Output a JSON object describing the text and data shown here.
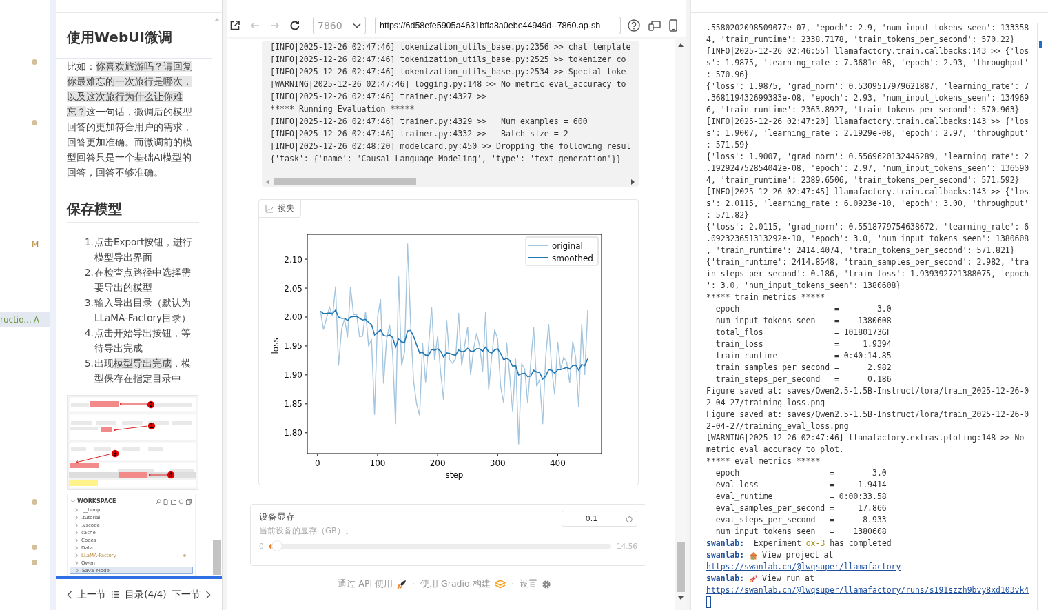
{
  "explorer_strip": {
    "rows": [
      {
        "kind": "dot",
        "color": "#d3bf9c"
      },
      {
        "kind": "blank"
      },
      {
        "kind": "blank"
      },
      {
        "kind": "blank"
      },
      {
        "kind": "dot",
        "color": "#d3bf9c"
      },
      {
        "kind": "blank"
      },
      {
        "kind": "blank"
      },
      {
        "kind": "blank"
      },
      {
        "kind": "blank"
      },
      {
        "kind": "blank"
      },
      {
        "kind": "blank"
      },
      {
        "kind": "blank"
      },
      {
        "kind": "status",
        "status": "M",
        "color": "#b5893f"
      },
      {
        "kind": "blank"
      },
      {
        "kind": "blank"
      },
      {
        "kind": "blank"
      },
      {
        "kind": "blank"
      },
      {
        "kind": "file",
        "name": "ructio...",
        "status": "A",
        "color": "#6b9a3e",
        "selected": true
      },
      {
        "kind": "blank"
      },
      {
        "kind": "blank"
      },
      {
        "kind": "blank"
      },
      {
        "kind": "blank"
      },
      {
        "kind": "blank"
      },
      {
        "kind": "blank"
      },
      {
        "kind": "blank"
      },
      {
        "kind": "blank"
      },
      {
        "kind": "blank"
      },
      {
        "kind": "blank"
      },
      {
        "kind": "blank"
      },
      {
        "kind": "dot",
        "color": "#d3bf9c"
      },
      {
        "kind": "blank"
      },
      {
        "kind": "blank"
      },
      {
        "kind": "dot",
        "color": "#d3bf9c"
      },
      {
        "kind": "dot",
        "color": "#d3bf9c"
      }
    ]
  },
  "tutorial": {
    "title": "使用WebUI微调",
    "paragraph": [
      {
        "kind": "text",
        "text": "比如："
      },
      {
        "kind": "code",
        "text": "你喜欢旅游吗？请回复你最难忘的一次旅行是哪次，以及这次旅行为什么让你难忘？"
      },
      {
        "kind": "text",
        "text": "这一句话，微调后的模型回答的更加符合用户的需求，回答更加准确。而微调前的模型回答只是一个基础AI模型的回答，回答不够准确。"
      }
    ],
    "heading": "保存模型",
    "steps": [
      {
        "number": "1.",
        "parts": [
          {
            "kind": "text",
            "text": "点击Export按钮，进行模型导出界面"
          }
        ]
      },
      {
        "number": "2.",
        "parts": [
          {
            "kind": "text",
            "text": "在检查点路径中选择需要导出的模型"
          }
        ]
      },
      {
        "number": "3.",
        "parts": [
          {
            "kind": "text",
            "text": "输入导出目录（默认为LLaMA-Factory目录）"
          }
        ]
      },
      {
        "number": "4.",
        "parts": [
          {
            "kind": "text",
            "text": "点击开始导出按钮，等待导出完成"
          }
        ]
      },
      {
        "number": "5.",
        "parts": [
          {
            "kind": "text",
            "text": "出现"
          },
          {
            "kind": "code",
            "text": "模型导出完成"
          },
          {
            "kind": "text",
            "text": "，模型保存在指定目录中"
          }
        ]
      }
    ],
    "figure_callouts": [
      "2",
      "1",
      "3",
      "4"
    ],
    "workspace": {
      "title": "WORKSPACE",
      "folders": [
        {
          "name": ".__temp",
          "modified": false,
          "selected": false
        },
        {
          "name": ".tutorial",
          "modified": false,
          "selected": false
        },
        {
          "name": ".vscode",
          "modified": false,
          "selected": false
        },
        {
          "name": "cache",
          "modified": false,
          "selected": false
        },
        {
          "name": "Codes",
          "modified": false,
          "selected": false
        },
        {
          "name": "Data",
          "modified": false,
          "selected": false
        },
        {
          "name": "LLaMA-Factory",
          "modified": true,
          "selected": false
        },
        {
          "name": "Qwen",
          "modified": false,
          "selected": false
        },
        {
          "name": "Sava_Model",
          "modified": false,
          "selected": true
        }
      ]
    },
    "nav": {
      "prev": "上一节",
      "toc": "目录(4/4)",
      "next": "下一节"
    }
  },
  "browser": {
    "nav_buttons": [
      {
        "kind": "external",
        "disabled": false
      },
      {
        "kind": "back",
        "disabled": true
      },
      {
        "kind": "forward",
        "disabled": true
      },
      {
        "kind": "reload",
        "disabled": false
      }
    ],
    "port": "7860",
    "url": "https://6d58efe5905a4631bffa8a0ebe44949d--7860.ap-sh",
    "tools": [
      {
        "kind": "help"
      },
      {
        "kind": "devices"
      },
      {
        "kind": "phone"
      }
    ]
  },
  "gradio": {
    "log_lines": [
      "[INFO|2025-12-26 02:47:46] tokenization_utils_base.py:2356 >> chat template",
      "[INFO|2025-12-26 02:47:46] tokenization_utils_base.py:2525 >> tokenizer co",
      "[INFO|2025-12-26 02:47:46] tokenization_utils_base.py:2534 >> Special toke",
      "[WARNING|2025-12-26 02:47:46] logging.py:148 >> No metric eval_accuracy to",
      "[INFO|2025-12-26 02:47:46] trainer.py:4327 >>",
      "***** Running Evaluation *****",
      "[INFO|2025-12-26 02:47:46] trainer.py:4329 >>   Num examples = 600",
      "[INFO|2025-12-26 02:47:46] trainer.py:4332 >>   Batch size = 2",
      "[INFO|2025-12-26 02:48:20] modelcard.py:450 >> Dropping the following resul",
      "{'task': {'name': 'Causal Language Modeling', 'type': 'text-generation'}}"
    ],
    "plot_tab": "损失",
    "chart_data": {
      "type": "line",
      "xlabel": "step",
      "ylabel": "loss",
      "x": [
        5,
        10,
        15,
        20,
        25,
        30,
        35,
        40,
        45,
        50,
        55,
        60,
        65,
        70,
        75,
        80,
        85,
        90,
        95,
        100,
        105,
        110,
        115,
        120,
        125,
        130,
        135,
        140,
        145,
        150,
        155,
        160,
        165,
        170,
        175,
        180,
        185,
        190,
        195,
        200,
        205,
        210,
        215,
        220,
        225,
        230,
        235,
        240,
        245,
        250,
        255,
        260,
        265,
        270,
        275,
        280,
        285,
        290,
        295,
        300,
        305,
        310,
        315,
        320,
        325,
        330,
        335,
        340,
        345,
        350,
        355,
        360,
        365,
        370,
        375,
        380,
        385,
        390,
        395,
        400,
        405,
        410,
        415,
        420,
        425,
        430,
        435,
        440,
        445,
        450
      ],
      "series": [
        {
          "name": "original",
          "color": "#a3c5de",
          "values": [
            2.01,
            1.978,
            1.998,
            2.017,
            2.001,
            2.053,
            1.916,
            1.978,
            1.997,
            1.965,
            2.052,
            2.004,
            2.005,
            1.966,
            1.967,
            2.009,
            1.951,
            1.96,
            1.831,
            2.0,
            2.031,
            1.885,
            1.96,
            1.987,
            1.94,
            1.815,
            2.07,
            1.916,
            1.94,
            2.127,
            1.99,
            1.89,
            1.85,
            1.83,
            1.955,
            1.887,
            1.95,
            2.017,
            1.926,
            1.967,
            1.905,
            1.856,
            1.995,
            1.926,
            1.92,
            1.928,
            2.007,
            1.916,
            1.95,
            1.982,
            1.9,
            1.945,
            1.972,
            1.95,
            1.906,
            2.009,
            1.874,
            1.93,
            1.978,
            1.962,
            1.88,
            1.851,
            1.956,
            1.9,
            1.836,
            1.928,
            1.78,
            1.919,
            1.91,
            1.852,
            1.92,
            1.982,
            1.88,
            1.892,
            1.815,
            1.932,
            1.988,
            1.91,
            1.866,
            1.957,
            1.91,
            1.93,
            1.922,
            1.886,
            1.958,
            1.93,
            1.844,
            1.988,
            1.9,
            2.012
          ]
        },
        {
          "name": "smoothed",
          "color": "#1f77b4",
          "values": [
            2.01,
            2.006,
            2.006,
            2.007,
            2.006,
            2.012,
            2.0,
            1.998,
            1.998,
            1.994,
            2.0,
            2.001,
            2.001,
            1.998,
            1.995,
            1.996,
            1.991,
            1.987,
            1.969,
            1.973,
            1.978,
            1.968,
            1.967,
            1.969,
            1.965,
            1.948,
            1.962,
            1.957,
            1.956,
            1.976,
            1.977,
            1.967,
            1.952,
            1.938,
            1.939,
            1.934,
            1.934,
            1.944,
            1.943,
            1.945,
            1.941,
            1.931,
            1.938,
            1.937,
            1.935,
            1.934,
            1.943,
            1.94,
            1.941,
            1.946,
            1.941,
            1.941,
            1.945,
            1.945,
            1.941,
            1.948,
            1.94,
            1.938,
            1.943,
            1.945,
            1.937,
            1.926,
            1.929,
            1.925,
            1.915,
            1.916,
            1.9,
            1.902,
            1.903,
            1.897,
            1.898,
            1.908,
            1.905,
            1.904,
            1.893,
            1.898,
            1.909,
            1.908,
            1.903,
            1.909,
            1.909,
            1.911,
            1.913,
            1.91,
            1.916,
            1.917,
            1.908,
            1.918,
            1.916,
            1.928
          ]
        }
      ],
      "legend": "upper right",
      "xlim": [
        -17,
        473
      ],
      "ylim": [
        1.764,
        2.143
      ],
      "xticks": [
        0,
        100,
        200,
        300,
        400
      ],
      "yticks": [
        {
          "value": 1.8,
          "label": "1.80"
        },
        {
          "value": 1.85,
          "label": "1.85"
        },
        {
          "value": 1.9,
          "label": "1.90"
        },
        {
          "value": 1.95,
          "label": "1.95"
        },
        {
          "value": 2.0,
          "label": "2.00"
        },
        {
          "value": 2.05,
          "label": "2.05"
        },
        {
          "value": 2.1,
          "label": "2.10"
        }
      ]
    },
    "slider": {
      "label": "设备显存",
      "info": "当前设备的显存（GB）。",
      "value": "0.1",
      "min": "0",
      "max": "14.56",
      "level": 0.007
    },
    "footer": [
      {
        "kind": "api",
        "text": "通过 API 使用"
      },
      {
        "kind": "separator",
        "text": "·"
      },
      {
        "kind": "gradio",
        "text": "使用 Gradio 构建"
      },
      {
        "kind": "separator",
        "text": "·"
      },
      {
        "kind": "settings",
        "text": "设置"
      }
    ]
  },
  "terminal": {
    "lines": [
      {
        "kind": "text",
        "text": ".5580202098509077e-07, 'epoch': 2.9, 'num_input_tokens_seen': 133358"
      },
      {
        "kind": "text",
        "text": "4, 'train_runtime': 2338.7178, 'train_tokens_per_second': 570.22}"
      },
      {
        "kind": "text",
        "text": "[INFO|2025-12-26 02:46:55] llamafactory.train.callbacks:143 >> {'los"
      },
      {
        "kind": "text",
        "text": "s': 1.9875, 'learning_rate': 7.3681e-08, 'epoch': 2.93, 'throughput'"
      },
      {
        "kind": "text",
        "text": ": 570.96}"
      },
      {
        "kind": "text",
        "text": "{'loss': 1.9875, 'grad_norm': 0.5309517979621887, 'learning_rate': 7"
      },
      {
        "kind": "text",
        "text": ".368119432699383e-08, 'epoch': 2.93, 'num_input_tokens_seen': 134969"
      },
      {
        "kind": "text",
        "text": "6, 'train_runtime': 2363.8927, 'train_tokens_per_second': 570.963}"
      },
      {
        "kind": "text",
        "text": "[INFO|2025-12-26 02:47:20] llamafactory.train.callbacks:143 >> {'los"
      },
      {
        "kind": "text",
        "text": "s': 1.9007, 'learning_rate': 2.1929e-08, 'epoch': 2.97, 'throughput'"
      },
      {
        "kind": "text",
        "text": ": 571.59}"
      },
      {
        "kind": "text",
        "text": "{'loss': 1.9007, 'grad_norm': 0.5569620132446289, 'learning_rate': 2"
      },
      {
        "kind": "text",
        "text": ".192924752854042e-08, 'epoch': 2.97, 'num_input_tokens_seen': 136590"
      },
      {
        "kind": "text",
        "text": "4, 'train_runtime': 2389.6506, 'train_tokens_per_second': 571.592}"
      },
      {
        "kind": "text",
        "text": "[INFO|2025-12-26 02:47:45] llamafactory.train.callbacks:143 >> {'los"
      },
      {
        "kind": "text",
        "text": "s': 2.0115, 'learning_rate': 6.0923e-10, 'epoch': 3.00, 'throughput'"
      },
      {
        "kind": "text",
        "text": ": 571.82}"
      },
      {
        "kind": "text",
        "text": "{'loss': 2.0115, 'grad_norm': 0.5518779754638672, 'learning_rate': 6"
      },
      {
        "kind": "text",
        "text": ".092323651313292e-10, 'epoch': 3.0, 'num_input_tokens_seen': 1380608"
      },
      {
        "kind": "text",
        "text": ", 'train_runtime': 2414.4074, 'train_tokens_per_second': 571.821}"
      },
      {
        "kind": "text",
        "text": "{'train_runtime': 2414.8548, 'train_samples_per_second': 2.982, 'tra"
      },
      {
        "kind": "text",
        "text": "in_steps_per_second': 0.186, 'train_loss': 1.939392721388075, 'epoch"
      },
      {
        "kind": "text",
        "text": "': 3.0, 'num_input_tokens_seen': 1380608}"
      },
      {
        "kind": "text",
        "text": "***** train metrics *****"
      },
      {
        "kind": "text",
        "text": "  epoch                    =        3.0"
      },
      {
        "kind": "text",
        "text": "  num_input_tokens_seen    =    1380608"
      },
      {
        "kind": "text",
        "text": "  total_flos               = 10180173GF"
      },
      {
        "kind": "text",
        "text": "  train_loss               =     1.9394"
      },
      {
        "kind": "text",
        "text": "  train_runtime            = 0:40:14.85"
      },
      {
        "kind": "text",
        "text": "  train_samples_per_second =      2.982"
      },
      {
        "kind": "text",
        "text": "  train_steps_per_second   =      0.186"
      },
      {
        "kind": "text",
        "text": "Figure saved at: saves/Qwen2.5-1.5B-Instruct/lora/train_2025-12-26-0"
      },
      {
        "kind": "text",
        "text": "2-04-27/training_loss.png"
      },
      {
        "kind": "text",
        "text": "Figure saved at: saves/Qwen2.5-1.5B-Instruct/lora/train_2025-12-26-0"
      },
      {
        "kind": "text",
        "text": "2-04-27/training_eval_loss.png"
      },
      {
        "kind": "text",
        "text": "[WARNING|2025-12-26 02:47:46] llamafactory.extras.ploting:148 >> No"
      },
      {
        "kind": "text",
        "text": "metric eval_accuracy to plot."
      },
      {
        "kind": "text",
        "text": "***** eval metrics *****"
      },
      {
        "kind": "text",
        "text": "  epoch                   =        3.0"
      },
      {
        "kind": "text",
        "text": "  eval_loss               =     1.9414"
      },
      {
        "kind": "text",
        "text": "  eval_runtime            = 0:00:33.58"
      },
      {
        "kind": "text",
        "text": "  eval_samples_per_second =     17.866"
      },
      {
        "kind": "text",
        "text": "  eval_steps_per_second   =      8.933"
      },
      {
        "kind": "text",
        "text": "  num_input_tokens_seen   =    1380608"
      },
      {
        "kind": "rich",
        "parts": [
          {
            "kind": "tag",
            "text": "swanlab:"
          },
          {
            "kind": "text",
            "text": " Experiment "
          },
          {
            "kind": "highlight",
            "text": "ox-3"
          },
          {
            "kind": "text",
            "text": " has completed"
          }
        ]
      },
      {
        "kind": "rich",
        "parts": [
          {
            "kind": "tag",
            "text": "swanlab:"
          },
          {
            "kind": "house"
          },
          {
            "kind": "text",
            "text": "View project at"
          }
        ]
      },
      {
        "kind": "link",
        "text": "https://swanlab.cn/@lwqsuper/llamafactory"
      },
      {
        "kind": "rich",
        "parts": [
          {
            "kind": "tag",
            "text": "swanlab:"
          },
          {
            "kind": "rocket"
          },
          {
            "kind": "text",
            "text": "View run at"
          }
        ]
      },
      {
        "kind": "link",
        "text": "https://swanlab.cn/@lwqsuper/llamafactory/runs/s191szzh9bvy8xd103vk4"
      },
      {
        "kind": "cursor"
      }
    ]
  }
}
